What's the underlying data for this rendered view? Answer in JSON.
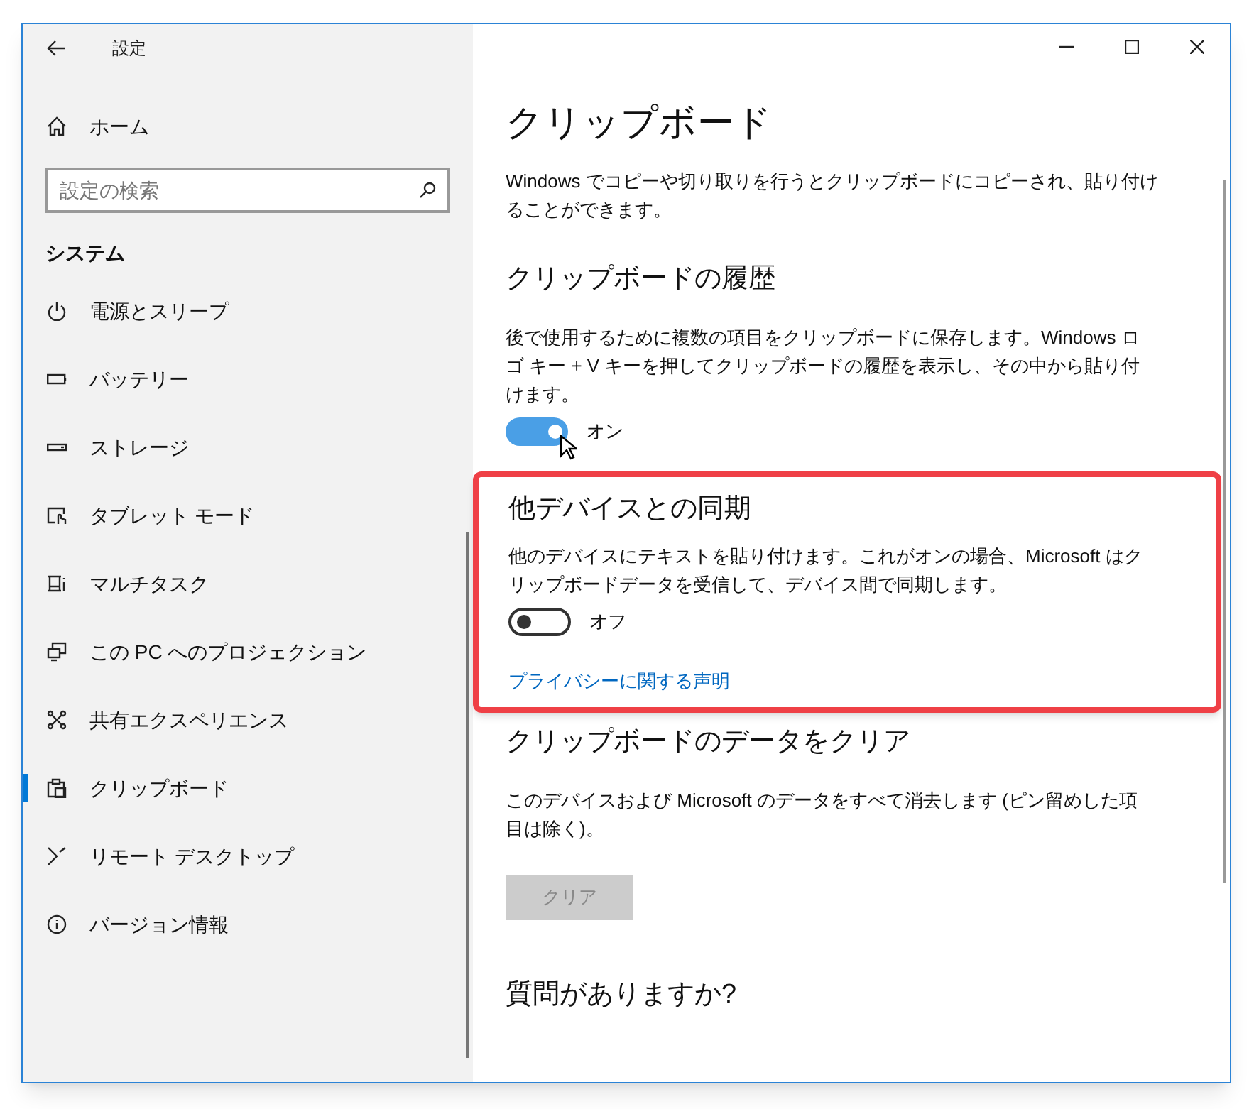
{
  "window": {
    "title": "設定"
  },
  "sidebar": {
    "home": "ホーム",
    "search": {
      "placeholder": "設定の検索"
    },
    "section": "システム",
    "items": [
      {
        "label": "電源とスリープ",
        "selected": false
      },
      {
        "label": "バッテリー",
        "selected": false
      },
      {
        "label": "ストレージ",
        "selected": false
      },
      {
        "label": "タブレット モード",
        "selected": false
      },
      {
        "label": "マルチタスク",
        "selected": false
      },
      {
        "label": "この PC へのプロジェクション",
        "selected": false
      },
      {
        "label": "共有エクスペリエンス",
        "selected": false
      },
      {
        "label": "クリップボード",
        "selected": true
      },
      {
        "label": "リモート デスクトップ",
        "selected": false
      },
      {
        "label": "バージョン情報",
        "selected": false
      }
    ]
  },
  "page": {
    "title": "クリップボード",
    "intro": "Windows でコピーや切り取りを行うとクリップボードにコピーされ、貼り付けることができます。",
    "sections": [
      {
        "kind": "toggle",
        "heading": "クリップボードの履歴",
        "text": "後で使用するために複数の項目をクリップボードに保存します。Windows ロゴ キー + V キーを押してクリップボードの履歴を表示し、その中から貼り付けます。",
        "on": true,
        "state_label": "オン",
        "highlighted": false
      },
      {
        "kind": "toggle",
        "heading": "他デバイスとの同期",
        "text": "他のデバイスにテキストを貼り付けます。これがオンの場合、Microsoft はクリップボードデータを受信して、デバイス間で同期します。",
        "on": false,
        "state_label": "オフ",
        "link": "プライバシーに関する声明",
        "highlighted": true
      },
      {
        "kind": "button",
        "heading": "クリップボードのデータをクリア",
        "text": "このデバイスおよび Microsoft のデータをすべて消去します (ピン留めした項目は除く)。",
        "button": "クリア",
        "disabled": true
      },
      {
        "kind": "heading",
        "heading": "質問がありますか?"
      }
    ]
  }
}
